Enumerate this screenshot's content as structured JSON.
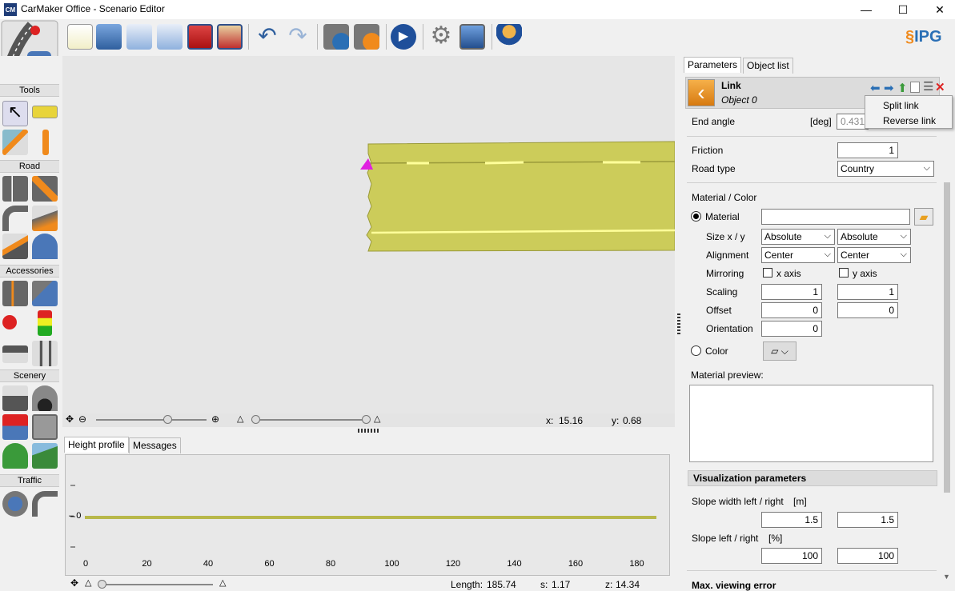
{
  "window": {
    "title": "CarMaker Office - Scenario Editor",
    "app_icon_text": "CM",
    "controls": {
      "minimize": "—",
      "maximize": "☐",
      "close": "✕"
    }
  },
  "toolbar": {
    "brand": "IPG"
  },
  "tools": {
    "categories": [
      "Tools",
      "Road",
      "Accessories",
      "Scenery",
      "Traffic"
    ]
  },
  "canvas": {
    "coord_x_label": "x:",
    "coord_x": "15.16",
    "coord_y_label": "y:",
    "coord_y": "0.68"
  },
  "lower": {
    "tabs": [
      "Height profile",
      "Messages"
    ],
    "profile": {
      "x_ticks": [
        "0",
        "20",
        "40",
        "60",
        "80",
        "100",
        "120",
        "140",
        "160",
        "180"
      ],
      "y_tick": "0"
    },
    "status": {
      "length_label": "Length:",
      "length": "185.74",
      "s_label": "s:",
      "s": "1.17",
      "z_label": "z:",
      "z": "14.34"
    }
  },
  "right": {
    "tabs": [
      "Parameters",
      "Object list"
    ],
    "object": {
      "type": "Link",
      "name": "Object 0"
    },
    "context_menu": [
      "Split link",
      "Reverse link"
    ],
    "end_angle": {
      "label": "End angle",
      "unit": "[deg]",
      "value": "0.431"
    },
    "friction": {
      "label": "Friction",
      "value": "1"
    },
    "road_type": {
      "label": "Road type",
      "value": "Country"
    },
    "material": {
      "header": "Material / Color",
      "material_label": "Material",
      "material_value": "",
      "size_label": "Size x / y",
      "size_x": "Absolute",
      "size_y": "Absolute",
      "align_label": "Alignment",
      "align_x": "Center",
      "align_y": "Center",
      "mirror_label": "Mirroring",
      "mirror_x": "x axis",
      "mirror_y": "y axis",
      "scaling_label": "Scaling",
      "scaling_x": "1",
      "scaling_y": "1",
      "offset_label": "Offset",
      "offset_x": "0",
      "offset_y": "0",
      "orientation_label": "Orientation",
      "orientation": "0",
      "color_label": "Color",
      "preview_label": "Material preview:"
    },
    "visualization": {
      "header": "Visualization parameters",
      "slope_width_label": "Slope width left / right",
      "slope_width_unit": "[m]",
      "slope_width_left": "1.5",
      "slope_width_right": "1.5",
      "slope_label": "Slope left / right",
      "slope_unit": "[%]",
      "slope_left": "100",
      "slope_right": "100",
      "max_err_header": "Max. viewing error"
    }
  },
  "colors": {
    "road": "#cccc5a",
    "road_edge": "#9a9a3a",
    "lane_mark": "#ffff9a",
    "accent": "#2a6fb5"
  }
}
